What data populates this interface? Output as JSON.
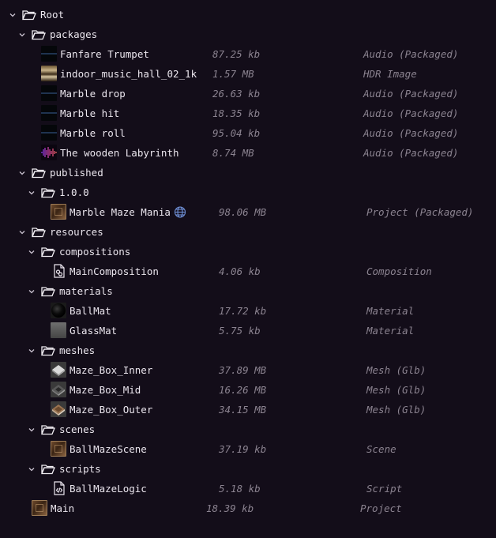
{
  "rows": [
    {
      "label": "Root",
      "size": "",
      "type": ""
    },
    {
      "label": "packages",
      "size": "",
      "type": ""
    },
    {
      "label": "Fanfare Trumpet",
      "size": "87.25 kb",
      "type": "Audio (Packaged)",
      "icon": "audio-thumbnail"
    },
    {
      "label": "indoor_music_hall_02_1k",
      "size": "1.57 MB",
      "type": "HDR Image",
      "icon": "hdr-thumbnail"
    },
    {
      "label": "Marble drop",
      "size": "26.63 kb",
      "type": "Audio (Packaged)",
      "icon": "audio-thumbnail"
    },
    {
      "label": "Marble hit",
      "size": "18.35 kb",
      "type": "Audio (Packaged)",
      "icon": "audio-thumbnail"
    },
    {
      "label": "Marble roll",
      "size": "95.04 kb",
      "type": "Audio (Packaged)",
      "icon": "audio-thumbnail"
    },
    {
      "label": "The wooden Labyrinth",
      "size": "8.74 MB",
      "type": "Audio (Packaged)",
      "icon": "waveform-thumbnail"
    },
    {
      "label": "published",
      "size": "",
      "type": ""
    },
    {
      "label": "1.0.0",
      "size": "",
      "type": ""
    },
    {
      "label": "Marble Maze Mania",
      "size": "98.06 MB",
      "type": "Project (Packaged)",
      "icon": "project-thumbnail"
    },
    {
      "label": "resources",
      "size": "",
      "type": ""
    },
    {
      "label": "compositions",
      "size": "",
      "type": ""
    },
    {
      "label": "MainComposition",
      "size": "4.06 kb",
      "type": "Composition",
      "icon": "composition-icon"
    },
    {
      "label": "materials",
      "size": "",
      "type": ""
    },
    {
      "label": "BallMat",
      "size": "17.72 kb",
      "type": "Material",
      "icon": "ball-material-thumbnail"
    },
    {
      "label": "GlassMat",
      "size": "5.75 kb",
      "type": "Material",
      "icon": "glass-material-thumbnail"
    },
    {
      "label": "meshes",
      "size": "",
      "type": ""
    },
    {
      "label": "Maze_Box_Inner",
      "size": "37.89 MB",
      "type": "Mesh (Glb)",
      "icon": "mesh-thumbnail"
    },
    {
      "label": "Maze_Box_Mid",
      "size": "16.26 MB",
      "type": "Mesh (Glb)",
      "icon": "mesh-thumbnail"
    },
    {
      "label": "Maze_Box_Outer",
      "size": "34.15 MB",
      "type": "Mesh (Glb)",
      "icon": "mesh-thumbnail"
    },
    {
      "label": "scenes",
      "size": "",
      "type": ""
    },
    {
      "label": "BallMazeScene",
      "size": "37.19 kb",
      "type": "Scene",
      "icon": "scene-thumbnail"
    },
    {
      "label": "scripts",
      "size": "",
      "type": ""
    },
    {
      "label": "BallMazeLogic",
      "size": "5.18 kb",
      "type": "Script",
      "icon": "script-icon"
    },
    {
      "label": "Main",
      "size": "18.39 kb",
      "type": "Project",
      "icon": "project-thumbnail"
    }
  ],
  "colors": {
    "background": "#130d19",
    "text": "#ebe6ee",
    "muted": "#8b8390",
    "accent": "#6e8fd6"
  }
}
